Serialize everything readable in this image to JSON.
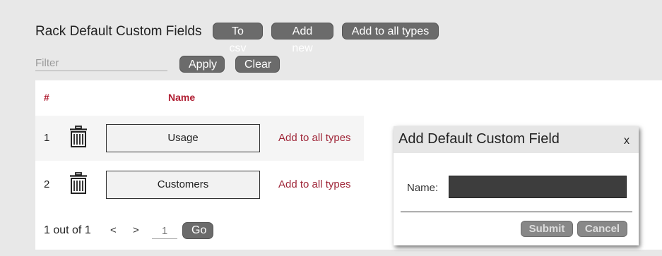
{
  "header": {
    "title": "Rack Default Custom Fields",
    "to_csv_label": "To csv",
    "add_new_label": "Add new",
    "add_to_all_types_label": "Add to all types"
  },
  "filter": {
    "placeholder": "Filter",
    "value": "",
    "apply_label": "Apply",
    "clear_label": "Clear"
  },
  "table": {
    "columns": [
      "#",
      "Name"
    ],
    "rows": [
      {
        "num": "1",
        "name": "Usage",
        "action": "Add to all types",
        "icon": "trash-icon"
      },
      {
        "num": "2",
        "name": "Customers",
        "action": "Add to all types",
        "icon": "trash-icon"
      }
    ]
  },
  "pager": {
    "summary": "1 out of 1",
    "prev": "<",
    "next": ">",
    "page_placeholder": "1",
    "go_label": "Go"
  },
  "dialog": {
    "title": "Add Default Custom Field",
    "close": "x",
    "name_label": "Name:",
    "name_value": "",
    "submit_label": "Submit",
    "cancel_label": "Cancel"
  },
  "colors": {
    "accent": "#b01e32",
    "button": "#6b6b6b",
    "background": "#e8e8e8"
  }
}
